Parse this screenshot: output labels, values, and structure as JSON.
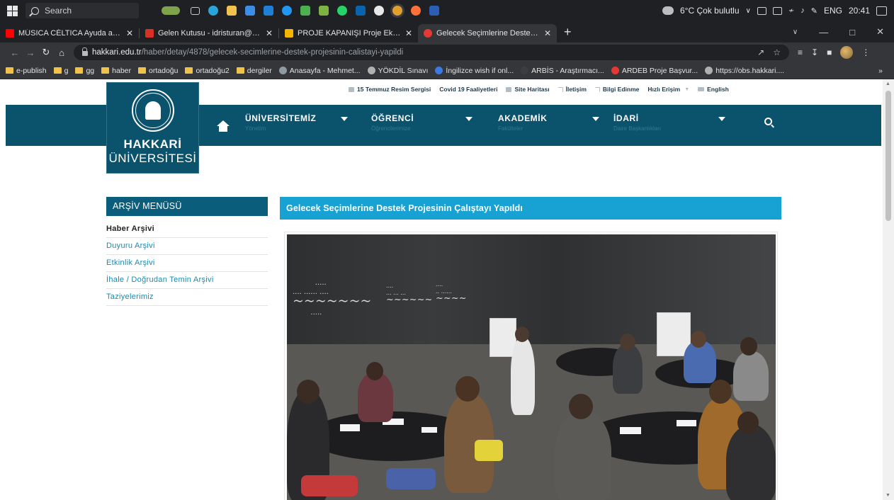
{
  "taskbar": {
    "search_placeholder": "Search",
    "weather": "6°C Çok bulutlu",
    "language": "ENG",
    "time": "20:41"
  },
  "tabs": [
    {
      "title": "MÚSICA CÉLTICA Ayuda a Calma",
      "favicon_color": "#ff0000"
    },
    {
      "title": "Gelen Kutusu - idristuran@hakk",
      "favicon_color": "#d93025"
    },
    {
      "title": "PROJE KAPANIŞI Proje Ekibi - Go",
      "favicon_color": "#f4b400"
    },
    {
      "title": "Gelecek Seçimlerine Destek Proj",
      "favicon_color": "#e53935"
    }
  ],
  "address": {
    "host": "hakkari.edu.tr",
    "path": "/haber/detay/4878/gelecek-secimlerine-destek-projesinin-calistayi-yapildi"
  },
  "bookmarks": [
    {
      "label": "e-publish",
      "type": "folder"
    },
    {
      "label": "g",
      "type": "folder"
    },
    {
      "label": "gg",
      "type": "folder"
    },
    {
      "label": "haber",
      "type": "folder"
    },
    {
      "label": "ortadoğu",
      "type": "folder"
    },
    {
      "label": "ortadoğu2",
      "type": "folder"
    },
    {
      "label": "dergiler",
      "type": "folder"
    },
    {
      "label": "Anasayfa - Mehmet...",
      "type": "site"
    },
    {
      "label": "YÖKDİL Sınavı",
      "type": "site"
    },
    {
      "label": "İngilizce wish if onl...",
      "type": "site"
    },
    {
      "label": "ARBİS - Araştırmacı...",
      "type": "site"
    },
    {
      "label": "ARDEB Proje Başvur...",
      "type": "site"
    },
    {
      "label": "https://obs.hakkari....",
      "type": "site"
    }
  ],
  "topbar": {
    "links": [
      "15 Temmuz Resim Sergisi",
      "Covid 19 Faaliyetleri",
      "Site Haritası",
      "İletişim",
      "Bilgi Edinme",
      "Hızlı Erişim",
      "English"
    ]
  },
  "logo": {
    "name": "HAKKARİ",
    "sub": "ÜNİVERSİTESİ"
  },
  "menu": [
    {
      "title": "ÜNİVERSİTEMİZ",
      "subtitle": "Yönetim"
    },
    {
      "title": "ÖĞRENCİ",
      "subtitle": "Öğrencilerimize"
    },
    {
      "title": "AKADEMİK",
      "subtitle": "Fakülteler"
    },
    {
      "title": "İDARİ",
      "subtitle": "Daire Başkanlıkları"
    }
  ],
  "sidebar": {
    "heading": "ARŞİV MENÜSÜ",
    "items": [
      "Haber Arşivi",
      "Duyuru Arşivi",
      "Etkinlik Arşivi",
      "İhale / Doğrudan Temin Arşivi",
      "Taziyelerimiz"
    ]
  },
  "article": {
    "title": "Gelecek Seçimlerine Destek Projesinin Çalıştayı Yapıldı"
  },
  "colors": {
    "nav_band": "#0b526d",
    "side_heading": "#0b5d7c",
    "title_bar": "#17a2d3",
    "link": "#1a8ab0"
  }
}
